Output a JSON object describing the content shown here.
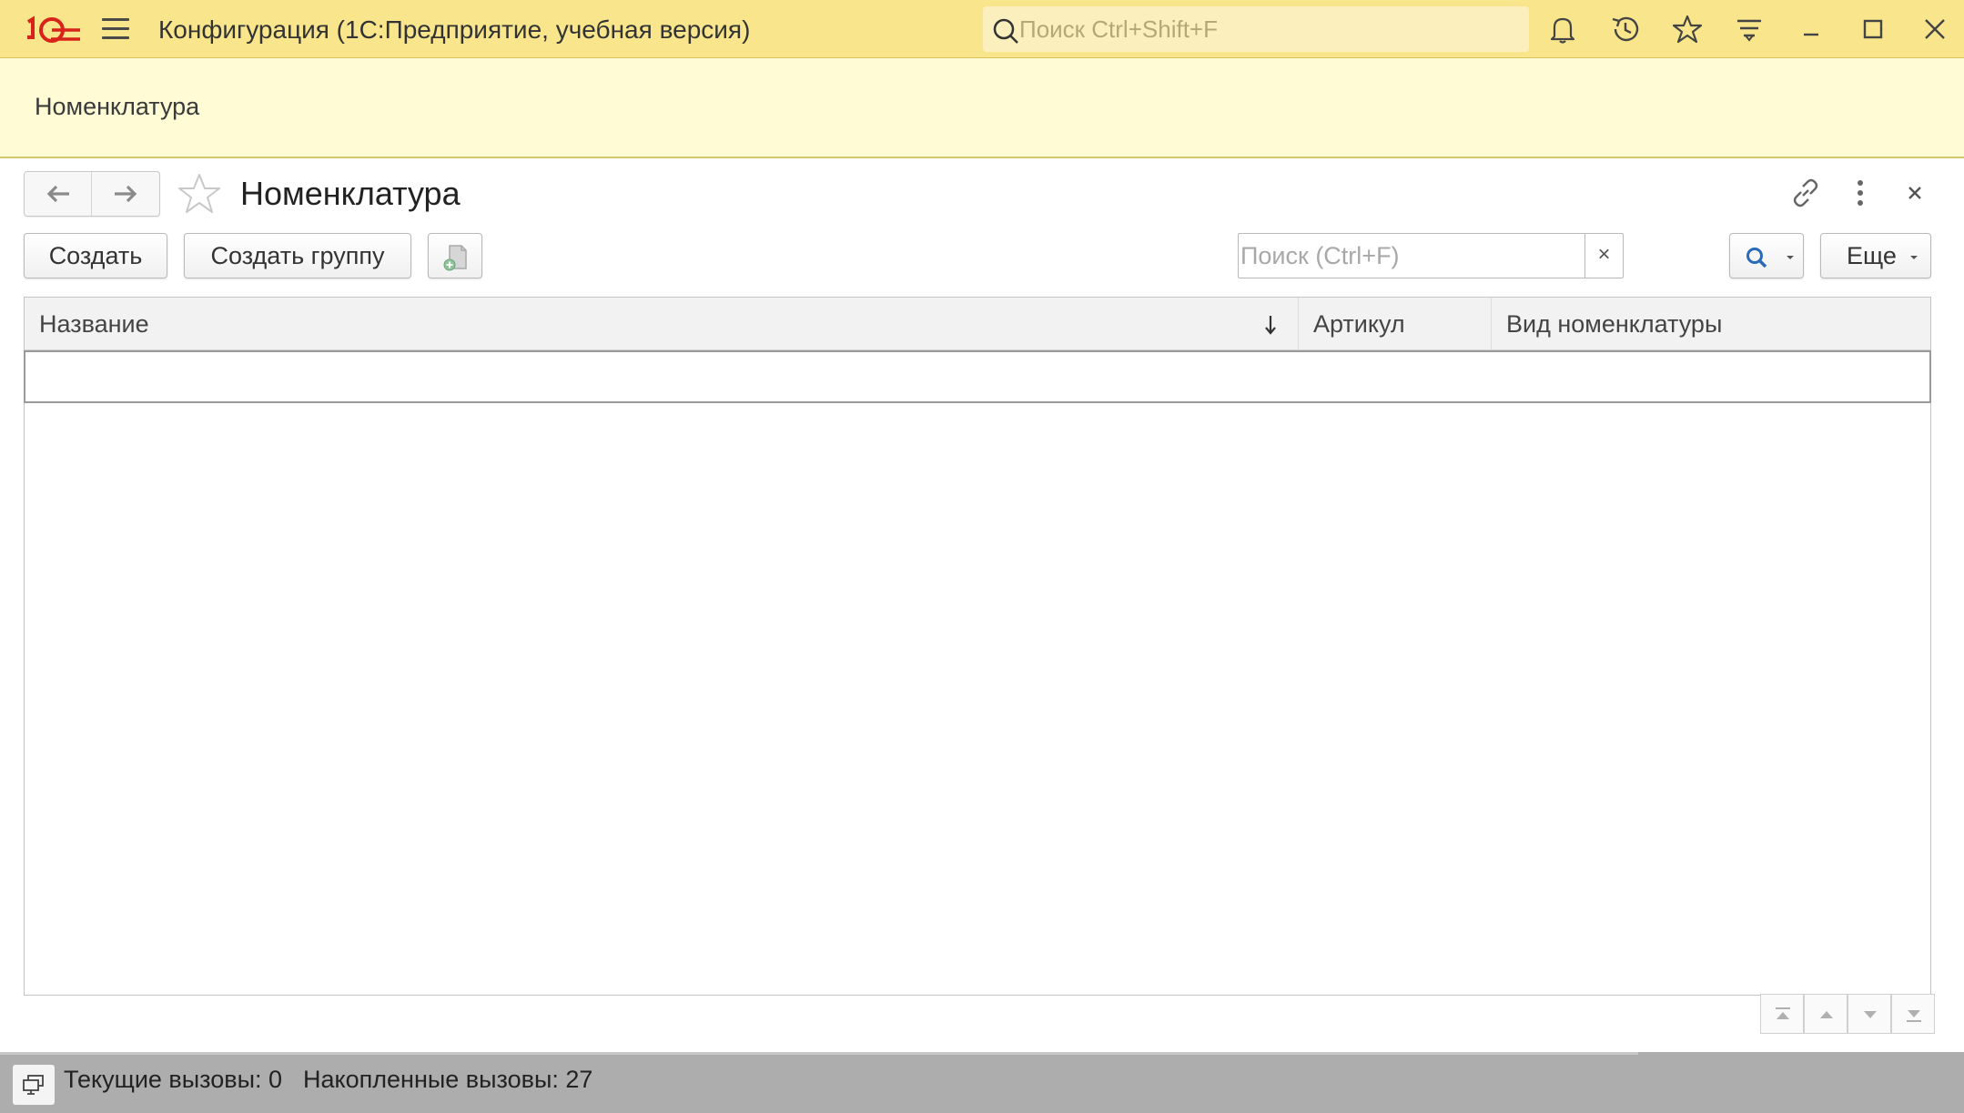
{
  "titlebar": {
    "app_title": "Конфигурация  (1С:Предприятие, учебная версия)",
    "search_placeholder": "Поиск Ctrl+Shift+F",
    "bg_color": "#f9e68c",
    "icons": [
      "1c-logo-icon",
      "menu-icon",
      "search-icon",
      "bell-icon",
      "history-icon",
      "star-icon",
      "filter-icon",
      "minimize-icon",
      "maximize-icon",
      "close-icon"
    ]
  },
  "section": {
    "link_label": "Номенклатура"
  },
  "form": {
    "title": "Номенклатура",
    "toolbar": {
      "create_label": "Создать",
      "create_group_label": "Создать группу",
      "search_placeholder": "Поиск (Ctrl+F)",
      "clear_label": "×",
      "more_label": "Еще"
    },
    "table": {
      "columns": [
        {
          "label": "Название",
          "sorted": "descending"
        },
        {
          "label": "Артикул"
        },
        {
          "label": "Вид номенклатуры"
        }
      ],
      "rows": []
    }
  },
  "statusbar": {
    "current_calls": "Текущие вызовы: 0",
    "accumulated_calls": "Накопленные вызовы: 27"
  },
  "colors": {
    "accent_red": "#d8231a",
    "section_bg": "#fefbd5",
    "status_bg": "#adadad"
  }
}
